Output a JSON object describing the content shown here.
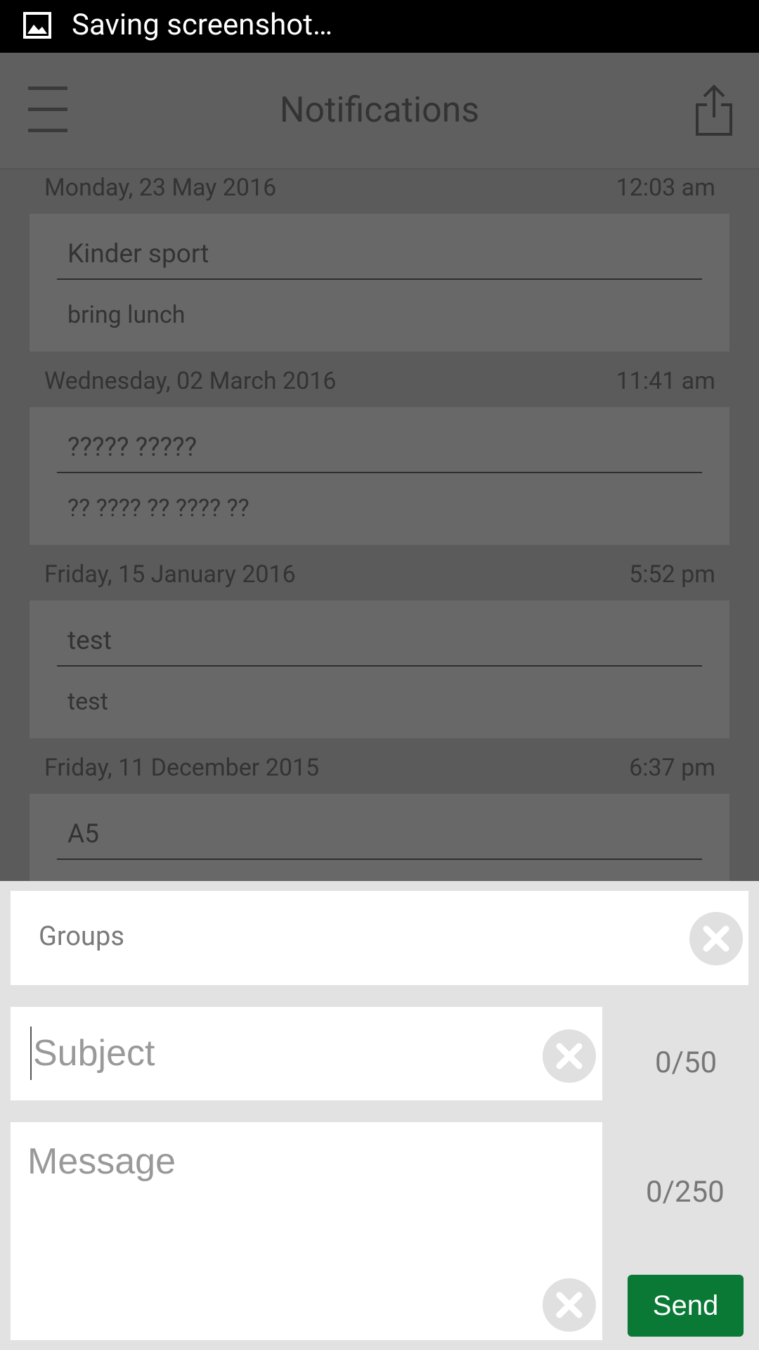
{
  "status_bar": {
    "text": "Saving screenshot…",
    "icon": "image-icon"
  },
  "app_bar": {
    "title": "Notifications",
    "menu_icon": "hamburger-menu-icon",
    "share_icon": "share-icon"
  },
  "notifications": [
    {
      "date": "Monday,  23 May 2016",
      "time": "12:03 am",
      "title": "Kinder sport",
      "body": "bring lunch"
    },
    {
      "date": "Wednesday,  02 March 2016",
      "time": "11:41 am",
      "title": "????? ?????",
      "body": "?? ???? ?? ???? ??"
    },
    {
      "date": "Friday,  15 January 2016",
      "time": "5:52 pm",
      "title": "test",
      "body": "test"
    },
    {
      "date": "Friday,  11 December 2015",
      "time": "6:37 pm",
      "title": "A5",
      "body": ""
    }
  ],
  "compose": {
    "groups_label": "Groups",
    "subject_placeholder": "Subject",
    "subject_counter": "0/50",
    "message_placeholder": "Message",
    "message_counter": "0/250",
    "send_label": "Send"
  },
  "colors": {
    "send_button": "#097935",
    "overlay": "#5c5c5c"
  }
}
